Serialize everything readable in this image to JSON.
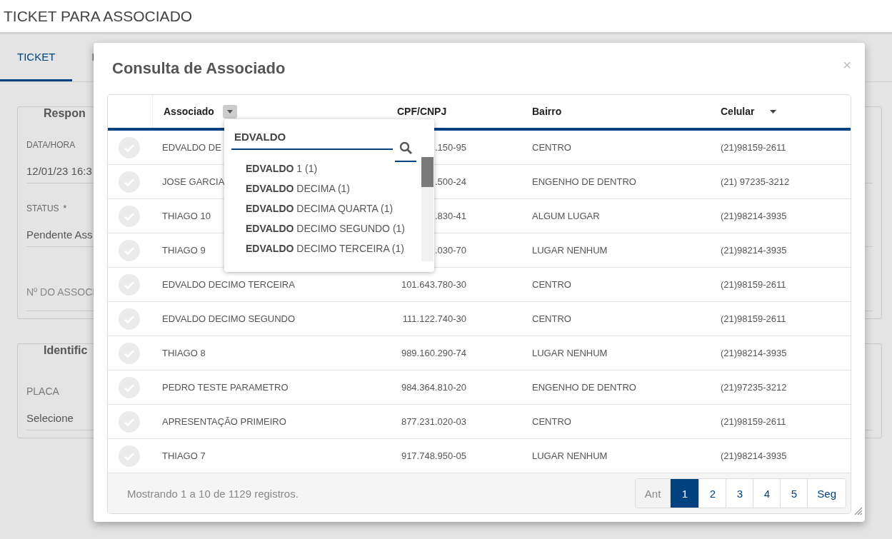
{
  "page": {
    "title": "TICKET PARA ASSOCIADO",
    "tabs": [
      {
        "label": "TICKET",
        "selected": true
      },
      {
        "label": "I",
        "selected": false
      }
    ],
    "sections": [
      {
        "legend": "Respon",
        "fields": [
          {
            "label": "DATA/HORA",
            "value": "12/01/23 16:3"
          },
          {
            "label": "STATUS",
            "required_mark": "*",
            "value": "Pendente Ass"
          },
          {
            "label": "Nº DO ASSOCI"
          }
        ]
      },
      {
        "legend": "Identific",
        "fields": [
          {
            "label": "PLACA",
            "value": "Selecione"
          }
        ]
      }
    ]
  },
  "modal": {
    "title": "Consulta de Associado",
    "close": "×",
    "table": {
      "columns": [
        {
          "label": "Associado",
          "filter": true,
          "sort": false
        },
        {
          "label": "CPF/CNPJ",
          "filter": false,
          "sort": false
        },
        {
          "label": "Bairro",
          "filter": false,
          "sort": false
        },
        {
          "label": "Celular",
          "filter": false,
          "sort": true
        }
      ],
      "rows": [
        {
          "selected": false,
          "cells": [
            "EDVALDO DE",
            ".150-95",
            "CENTRO",
            "(21)98159-2611"
          ]
        },
        {
          "selected": false,
          "cells": [
            "JOSE GARCIA",
            ".500-24",
            "ENGENHO DE DENTRO",
            "(21) 97235-3212"
          ]
        },
        {
          "selected": false,
          "cells": [
            "THIAGO 10",
            ".830-41",
            "ALGUM LUGAR",
            "(21)98214-3935"
          ]
        },
        {
          "selected": false,
          "cells": [
            "THIAGO 9",
            ".030-70",
            "LUGAR NENHUM",
            "(21)98214-3935"
          ]
        },
        {
          "selected": false,
          "cells": [
            "EDVALDO DECIMO TERCEIRA",
            "101.643.780-30",
            "CENTRO",
            "(21)98159-2611"
          ]
        },
        {
          "selected": false,
          "cells": [
            "EDVALDO DECIMO SEGUNDO",
            "111.122.740-30",
            "CENTRO",
            "(21)98159-2611"
          ]
        },
        {
          "selected": false,
          "cells": [
            "THIAGO 8",
            "989.160.290-74",
            "LUGAR NENHUM",
            "(21)98214-3935"
          ]
        },
        {
          "selected": false,
          "cells": [
            "PEDRO TESTE PARAMETRO",
            "984.364.810-20",
            "ENGENHO DE DENTRO",
            "(21)97235-3212"
          ]
        },
        {
          "selected": false,
          "cells": [
            "APRESENTAÇÃO PRIMEIRO",
            "877.231.020-03",
            "CENTRO",
            "(21)98159-2611"
          ]
        },
        {
          "selected": false,
          "cells": [
            "THIAGO 7",
            "917.748.950-05",
            "LUGAR NENHUM",
            "(21)98214-3935"
          ]
        }
      ]
    },
    "filter_dropdown": {
      "value": "EDVALDO",
      "options": [
        "**EDVALDO** 1 (1)",
        "**EDVALDO** DECIMA (1)",
        "**EDVALDO** DECIMA QUARTA (1)",
        "**EDVALDO** DECIMO SEGUNDO (1)",
        "**EDVALDO** DECIMO TERCEIRA (1)"
      ]
    },
    "footer": {
      "summary": "Mostrando 1 a 10 de 1129 registros.",
      "pagination": [
        {
          "label": "Ant",
          "kind": "nav",
          "selected": false
        },
        {
          "label": "1",
          "kind": "page",
          "selected": true
        },
        {
          "label": "2",
          "kind": "page",
          "selected": false
        },
        {
          "label": "3",
          "kind": "page",
          "selected": false
        },
        {
          "label": "4",
          "kind": "page",
          "selected": false
        },
        {
          "label": "5",
          "kind": "page",
          "selected": false
        },
        {
          "label": "Seg",
          "kind": "next",
          "selected": false
        }
      ]
    }
  }
}
